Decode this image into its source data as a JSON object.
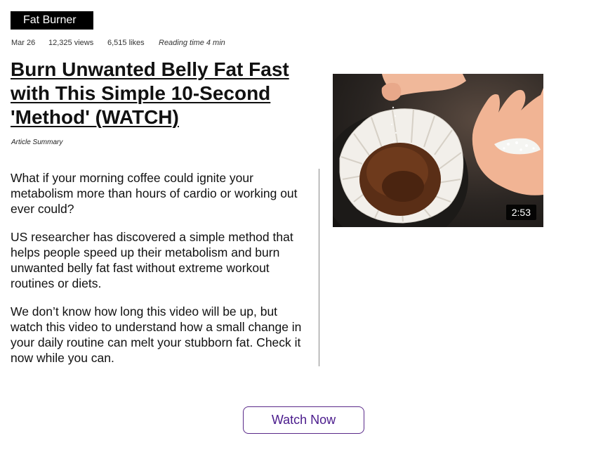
{
  "category": "Fat Burner",
  "meta": {
    "date": "Mar 26",
    "views": "12,325 views",
    "likes": "6,515 likes",
    "reading_time": "Reading time 4 min"
  },
  "article": {
    "title": "Burn Unwanted Belly Fat Fast with This Simple 10-Second 'Method' (WATCH)",
    "summary_label": "Article Summary",
    "paragraphs": [
      "What if your morning coffee could ignite your metabolism more than hours of cardio or working out ever could?",
      "US researcher has discovered a simple method that helps people speed up their metabolism and burn unwanted belly fat fast without extreme workout routines or diets.",
      "We don’t know how long this video will be up, but watch this video to understand how a small change in your daily routine can melt your stubborn fat. Check it now while you can."
    ]
  },
  "video": {
    "duration": "2:53"
  },
  "cta": {
    "label": "Watch Now"
  }
}
